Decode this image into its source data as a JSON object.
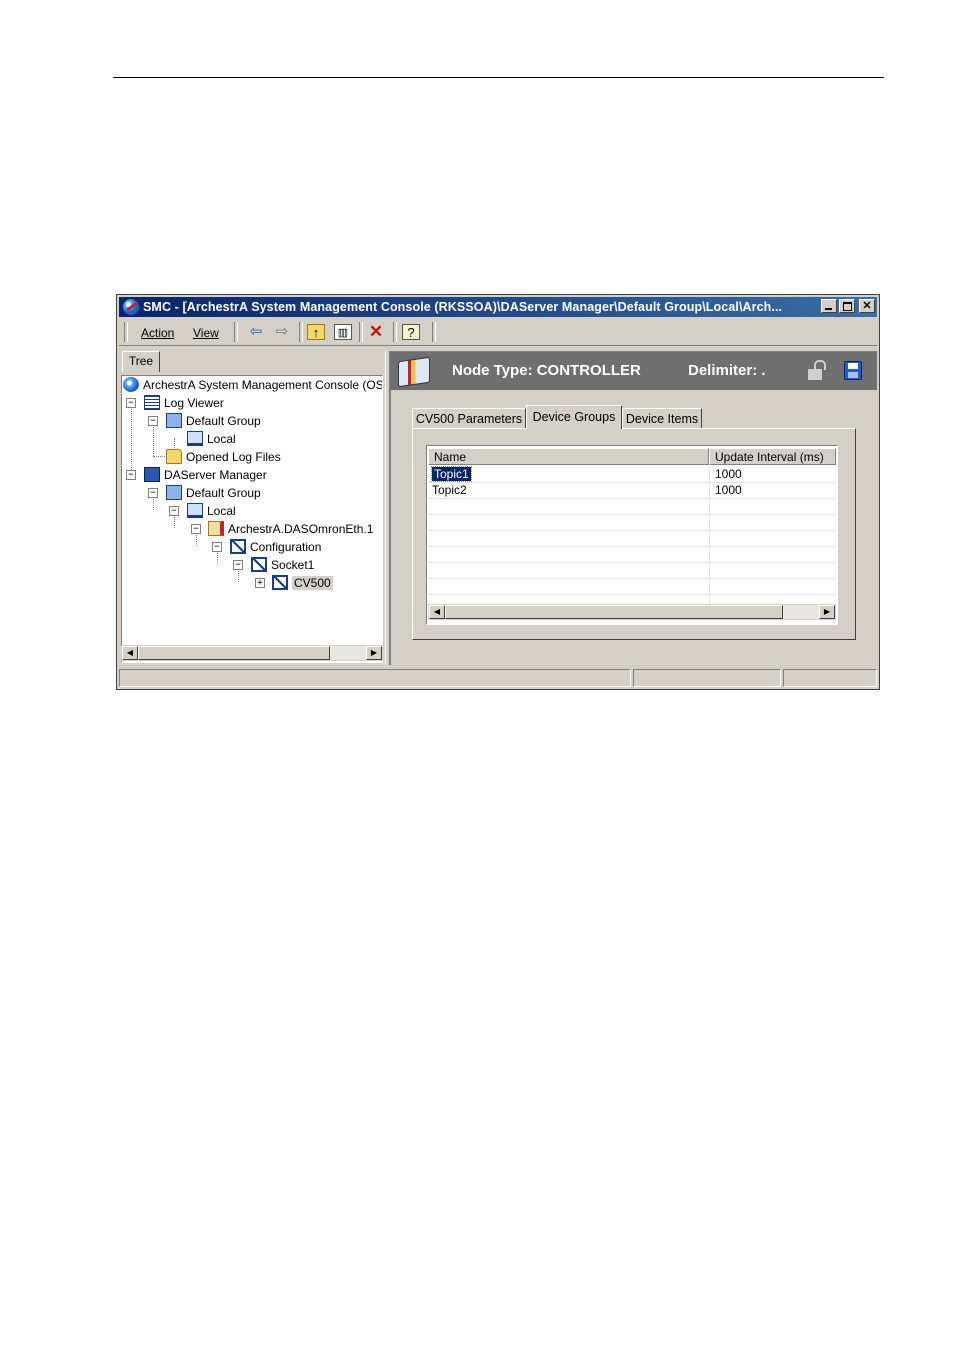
{
  "window": {
    "title": "SMC - [ArchestrA System Management Console (RKSSOA)\\DAServer Manager\\Default Group\\Local\\Arch..."
  },
  "menubar": {
    "action_label": "Action",
    "view_label": "View",
    "toolbar_icons": [
      "back-arrow-icon",
      "forward-arrow-icon",
      "up-folder-icon",
      "show-hide-tree-icon",
      "delete-icon",
      "help-icon"
    ]
  },
  "left_panel": {
    "tab_label": "Tree",
    "tree": [
      {
        "label": "ArchestrA System Management Console (OS",
        "icon": "console-icon"
      },
      {
        "label": "Log Viewer",
        "icon": "log-viewer-icon"
      },
      {
        "label": "Default Group",
        "icon": "group-icon"
      },
      {
        "label": "Local",
        "icon": "computer-icon"
      },
      {
        "label": "Opened Log Files",
        "icon": "folder-icon"
      },
      {
        "label": "DAServer Manager",
        "icon": "server-manager-icon"
      },
      {
        "label": "Default Group",
        "icon": "group-icon"
      },
      {
        "label": "Local",
        "icon": "computer-icon"
      },
      {
        "label": "ArchestrA.DASOmronEth.1",
        "icon": "daserver-icon"
      },
      {
        "label": "Configuration",
        "icon": "configuration-icon"
      },
      {
        "label": "Socket1",
        "icon": "socket-icon"
      },
      {
        "label": "CV500",
        "icon": "controller-icon",
        "selected": true
      }
    ]
  },
  "node_header": {
    "node_type": "Node Type: CONTROLLER",
    "delimiter": "Delimiter:  .",
    "colors": {
      "background": "#6f6f6f",
      "text": "#ffffff"
    }
  },
  "tabs": [
    {
      "label": "CV500 Parameters",
      "active": false
    },
    {
      "label": "Device Groups",
      "active": true
    },
    {
      "label": "Device Items",
      "active": false
    }
  ],
  "device_groups_grid": {
    "columns": [
      "Name",
      "Update Interval (ms)"
    ],
    "rows": [
      {
        "name": "Topic1",
        "update_interval": "1000",
        "selected": true
      },
      {
        "name": "Topic2",
        "update_interval": "1000",
        "selected": false
      }
    ]
  },
  "colors": {
    "title_gradient_start": "#0a246a",
    "title_gradient_end": "#3a6ea5",
    "chrome": "#d4d0c8",
    "selection": "#0a246a"
  }
}
